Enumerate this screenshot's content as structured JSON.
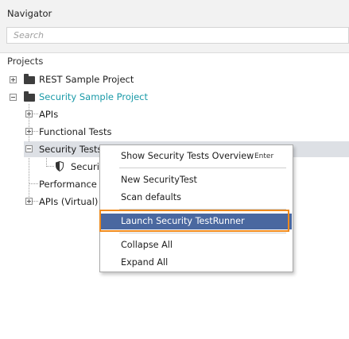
{
  "navigator": {
    "title": "Navigator",
    "search_placeholder": "Search",
    "projects_label": "Projects"
  },
  "tree": {
    "rest_project": "REST Sample Project",
    "security_project": "Security Sample Project",
    "apis": "APIs",
    "functional_tests": "Functional Tests",
    "security_tests": "Security Tests",
    "security_child": "Securit",
    "performance_tests": "Performance T",
    "apis_virtual": "APIs (Virtual)"
  },
  "context_menu": {
    "show_overview": "Show Security Tests Overview",
    "show_overview_shortcut": "Enter",
    "new_test": "New SecurityTest",
    "scan_defaults": "Scan defaults",
    "launch_runner": "Launch Security TestRunner",
    "collapse_all": "Collapse All",
    "expand_all": "Expand All"
  },
  "colors": {
    "selected_project": "#1a9aa8",
    "menu_selection": "#4a68a0",
    "highlight_frame": "#f08a1c",
    "tree_row_highlight": "#dde0e5"
  }
}
